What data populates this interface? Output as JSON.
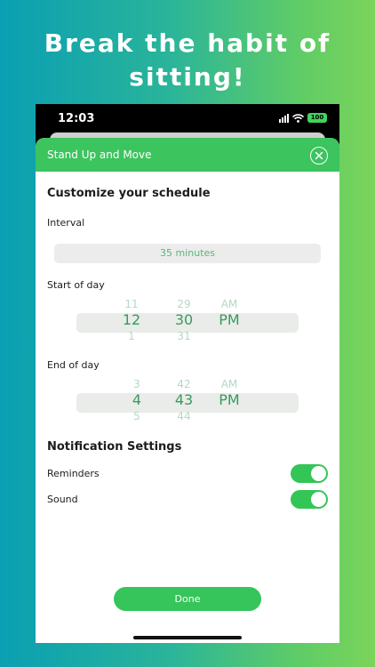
{
  "headline": {
    "line1": "Break the habit of",
    "line2": "sitting!"
  },
  "status_bar": {
    "time": "12:03",
    "battery": "100"
  },
  "sheet": {
    "title": "Stand Up and Move"
  },
  "schedule": {
    "heading": "Customize your schedule",
    "interval_label": "Interval",
    "interval_value": "35 minutes",
    "start_label": "Start of day",
    "start_picker": {
      "hours": [
        "11",
        "12",
        "1"
      ],
      "minutes": [
        "29",
        "30",
        "31"
      ],
      "periods": [
        "AM",
        "PM"
      ]
    },
    "end_label": "End of day",
    "end_picker": {
      "hours": [
        "3",
        "4",
        "5"
      ],
      "minutes": [
        "42",
        "43",
        "44"
      ],
      "periods": [
        "AM",
        "PM"
      ]
    }
  },
  "notifications": {
    "heading": "Notification Settings",
    "reminders_label": "Reminders",
    "reminders_on": true,
    "sound_label": "Sound",
    "sound_on": true
  },
  "done_label": "Done",
  "colors": {
    "accent": "#3cc45e",
    "picker_selected": "#3a9a5c",
    "picker_faded": "#b3d9c1"
  },
  "icons": {
    "close": "close-circle-icon",
    "signal": "signal-icon",
    "wifi": "wifi-icon",
    "battery": "battery-icon"
  }
}
